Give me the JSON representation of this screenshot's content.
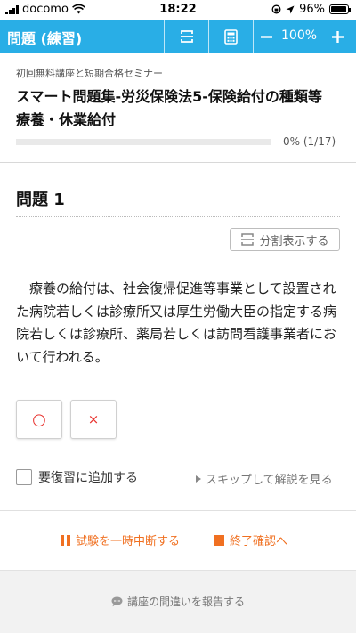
{
  "status_bar": {
    "carrier": "docomo",
    "time": "18:22",
    "battery_text": "96%",
    "battery_level": 0.96
  },
  "app_bar": {
    "title": "問題 (練習)",
    "zoom": "100%",
    "accent_color": "#29aee6",
    "icons": [
      "split-view-icon",
      "calculator-icon",
      "minus-icon",
      "plus-icon"
    ]
  },
  "header": {
    "subtitle": "初回無料講座と短期合格セミナー",
    "title": "スマート問題集-労災保険法5-保険給付の種類等　療養・休業給付",
    "progress_fraction": 0,
    "progress_text": "0% (1/17)"
  },
  "question": {
    "heading": "問題 1",
    "split_button": "分割表示する",
    "text": "療養の給付は、社会復帰促進等事業として設置された病院若しくは診療所又は厚生労働大臣の指定する病院若しくは診療所、薬局若しくは訪問看護事業者において行われる。",
    "answer_true": "○",
    "answer_false": "×",
    "answer_color": "#e8332f"
  },
  "review": {
    "checkbox_label": "要復習に追加する",
    "skip_label": "スキップして解説を見る"
  },
  "footer": {
    "pause_label": "試験を一時中断する",
    "finish_label": "終了確認へ",
    "action_color": "#f07021",
    "report_label": "講座の間違いを報告する"
  }
}
